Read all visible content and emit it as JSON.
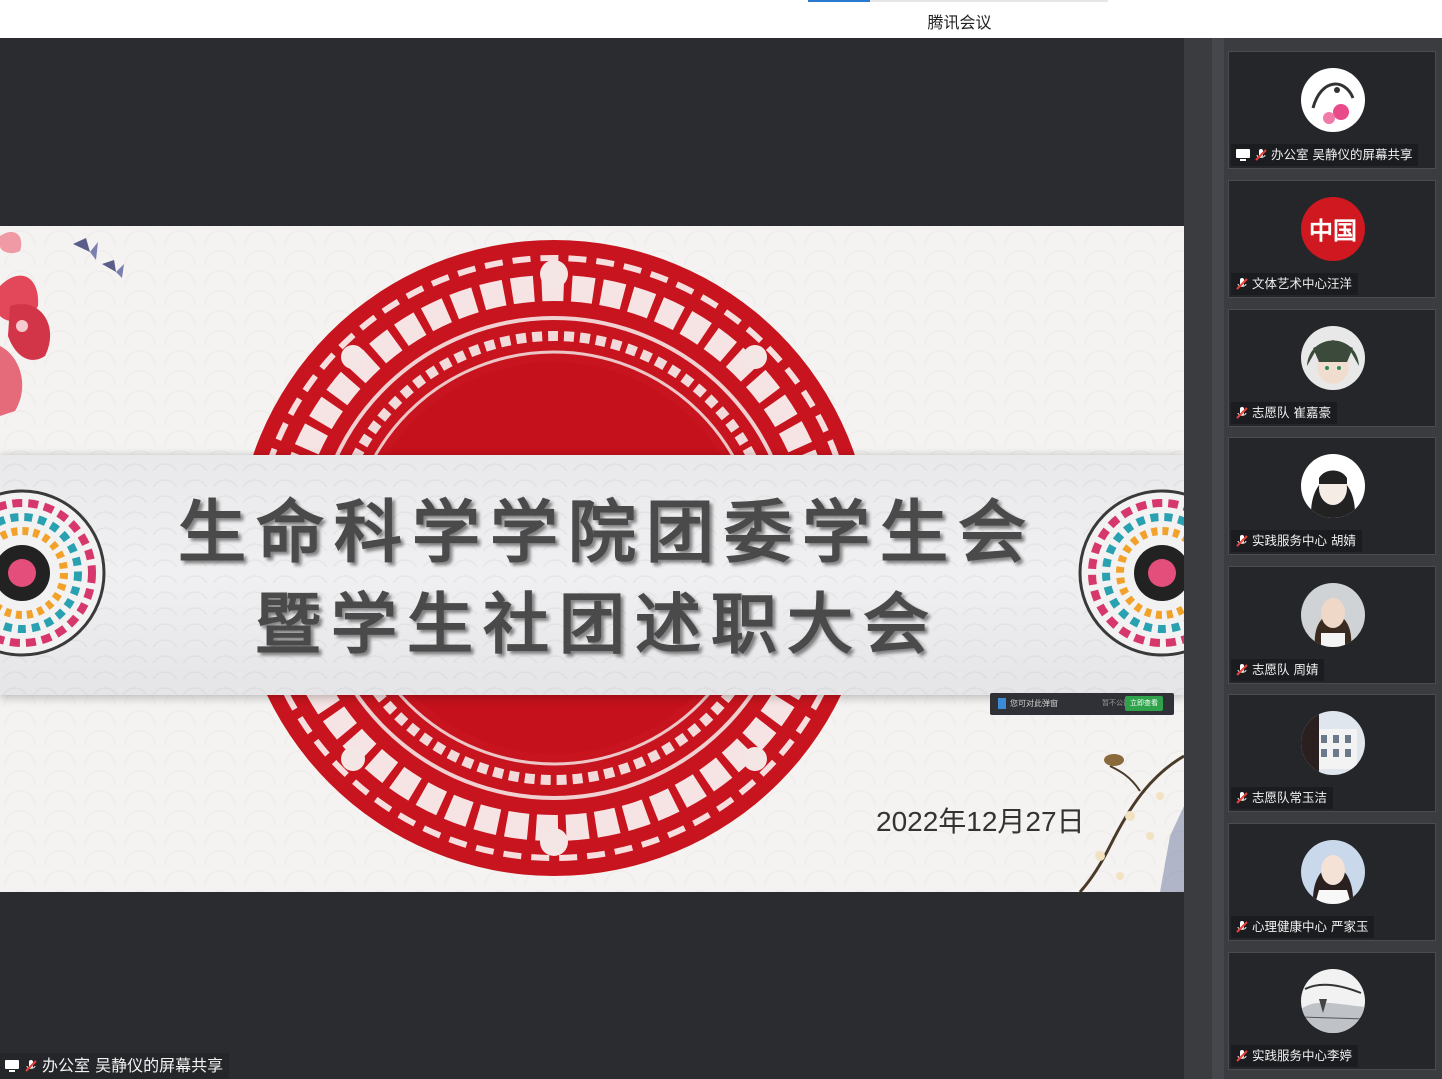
{
  "window": {
    "title": "腾讯会议"
  },
  "slide": {
    "title_line1": "生命科学学院团委学生会",
    "title_line2": "暨学生社团述职大会",
    "date": "2022年12月27日"
  },
  "notice": {
    "text": "您可对此弹窗",
    "later": "暂不公告",
    "button": "立即查看"
  },
  "stage": {
    "presenter_label": "办公室 吴静仪的屏幕共享"
  },
  "participants": [
    {
      "name": "办公室 吴静仪的屏幕共享",
      "sharing": true,
      "avatar": "avatar-cartoon-bird"
    },
    {
      "name": "文体艺术中心汪洋",
      "sharing": false,
      "avatar": "avatar-china-logo",
      "avatar_text": "中国"
    },
    {
      "name": "志愿队 崔嘉豪",
      "sharing": false,
      "avatar": "avatar-anime-boy"
    },
    {
      "name": "实践服务中心 胡婧",
      "sharing": false,
      "avatar": "avatar-anime-girl"
    },
    {
      "name": "志愿队 周婧",
      "sharing": false,
      "avatar": "avatar-photo-girl"
    },
    {
      "name": "志愿队常玉洁",
      "sharing": false,
      "avatar": "avatar-building"
    },
    {
      "name": "心理健康中心  严家玉",
      "sharing": false,
      "avatar": "avatar-photo-woman"
    },
    {
      "name": "实践服务中心李婷",
      "sharing": false,
      "avatar": "avatar-landscape"
    }
  ],
  "colors": {
    "accent": "#2b78d0",
    "medallion_red": "#c8141e",
    "stage_bg": "#2a2c2f",
    "sidebar_bg": "#3a3c40",
    "notice_button": "#2fa34c"
  }
}
